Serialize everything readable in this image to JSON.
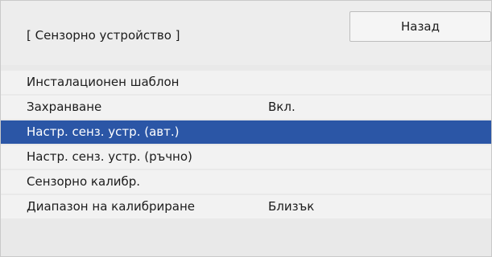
{
  "header": {
    "title": "[ Сензорно устройство ]",
    "back_label": "Назад"
  },
  "menu": {
    "selected_index": 2,
    "items": [
      {
        "label": "Инсталационен шаблон",
        "value": ""
      },
      {
        "label": "Захранване",
        "value": "Вкл."
      },
      {
        "label": "Настр. сенз. устр. (авт.)",
        "value": ""
      },
      {
        "label": "Настр. сенз. устр. (ръчно)",
        "value": ""
      },
      {
        "label": "Сензорно калибр.",
        "value": ""
      },
      {
        "label": "Диапазон на калибриране",
        "value": "Близък"
      }
    ]
  },
  "colors": {
    "selection": "#2b56a6",
    "row_background": "#f2f2f2",
    "panel_background": "#e9e9e9"
  }
}
